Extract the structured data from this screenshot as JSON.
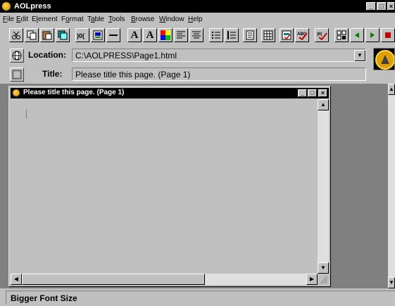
{
  "app": {
    "title": "AOLpress"
  },
  "menu": [
    "File",
    "Edit",
    "Element",
    "Format",
    "Table",
    "Tools",
    "Browse",
    "Window",
    "Help"
  ],
  "menu_mnemonic": [
    "F",
    "E",
    "l",
    "o",
    "a",
    "T",
    "B",
    "W",
    "H"
  ],
  "location": {
    "label": "Location:",
    "value": "C:\\AOLPRESS\\Page1.html"
  },
  "title_row": {
    "label": "Title:",
    "value": "Please title this page. (Page 1)"
  },
  "document": {
    "window_title": "Please title this page. (Page 1)"
  },
  "status": {
    "text": "Bigger Font Size"
  },
  "toolbar": {
    "icons": [
      "cut-icon",
      "copy-icon",
      "paste-icon",
      "duplicate-icon",
      "anchor-icon",
      "image-icon",
      "horizontal-rule-icon",
      "bigger-font-icon",
      "smaller-font-icon",
      "color-icon",
      "align-left-icon",
      "align-center-icon",
      "bulleted-list-icon",
      "numbered-list-icon",
      "document-icon",
      "table-icon",
      "form-icon",
      "spellcheck-icon",
      "link-check-icon",
      "map-icon",
      "back-icon",
      "forward-icon",
      "stop-icon"
    ]
  }
}
